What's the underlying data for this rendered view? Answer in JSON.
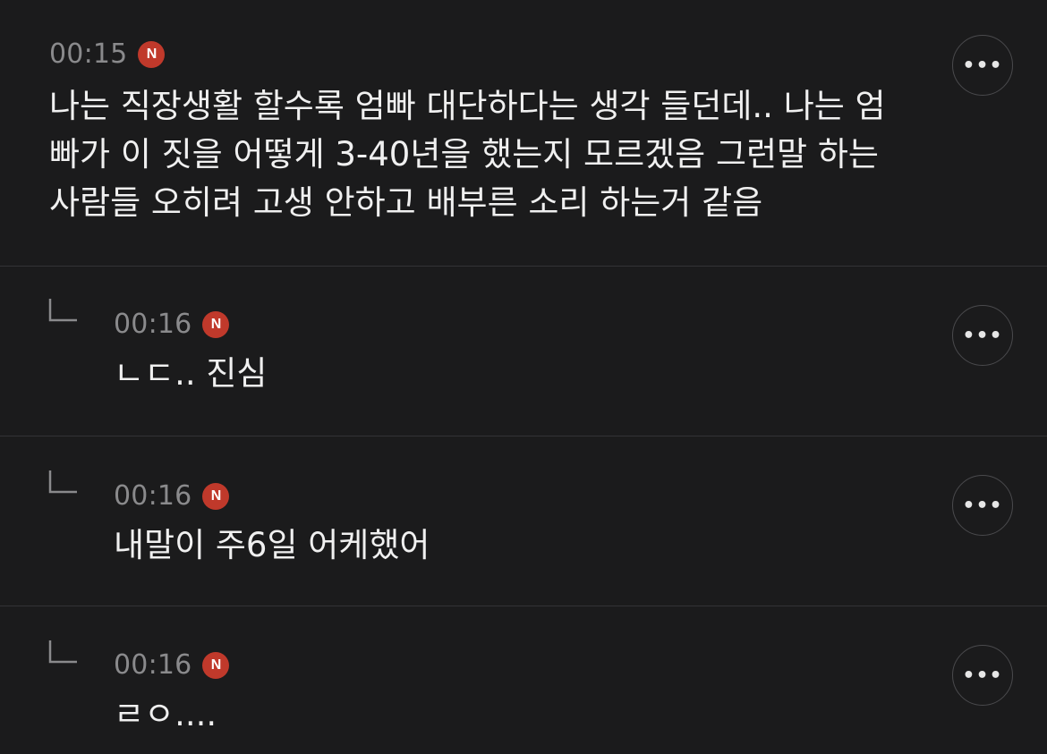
{
  "comments": [
    {
      "time": "00:15",
      "badge": "N",
      "lines": [
        "나는 직장생활 할수록 엄빠 대단하다는 생각 들던데.. 나는 엄",
        "빠가 이 짓을 어떻게 3-40년을 했는지 모르겠음 그런말 하는",
        "사람들 오히려 고생 안하고 배부른 소리 하는거 같음"
      ],
      "more": "•••"
    },
    {
      "time": "00:16",
      "badge": "N",
      "text": "ㄴㄷ.. 진심",
      "more": "•••"
    },
    {
      "time": "00:16",
      "badge": "N",
      "text": "내말이 주6일 어케했어",
      "more": "•••"
    },
    {
      "time": "00:16",
      "badge": "N",
      "text": "ㄹㅇ....",
      "more": "•••"
    }
  ],
  "colors": {
    "background": "#1b1b1c",
    "divider": "#333336",
    "badge": "#c0392b",
    "timestamp": "#8a8a8c"
  }
}
